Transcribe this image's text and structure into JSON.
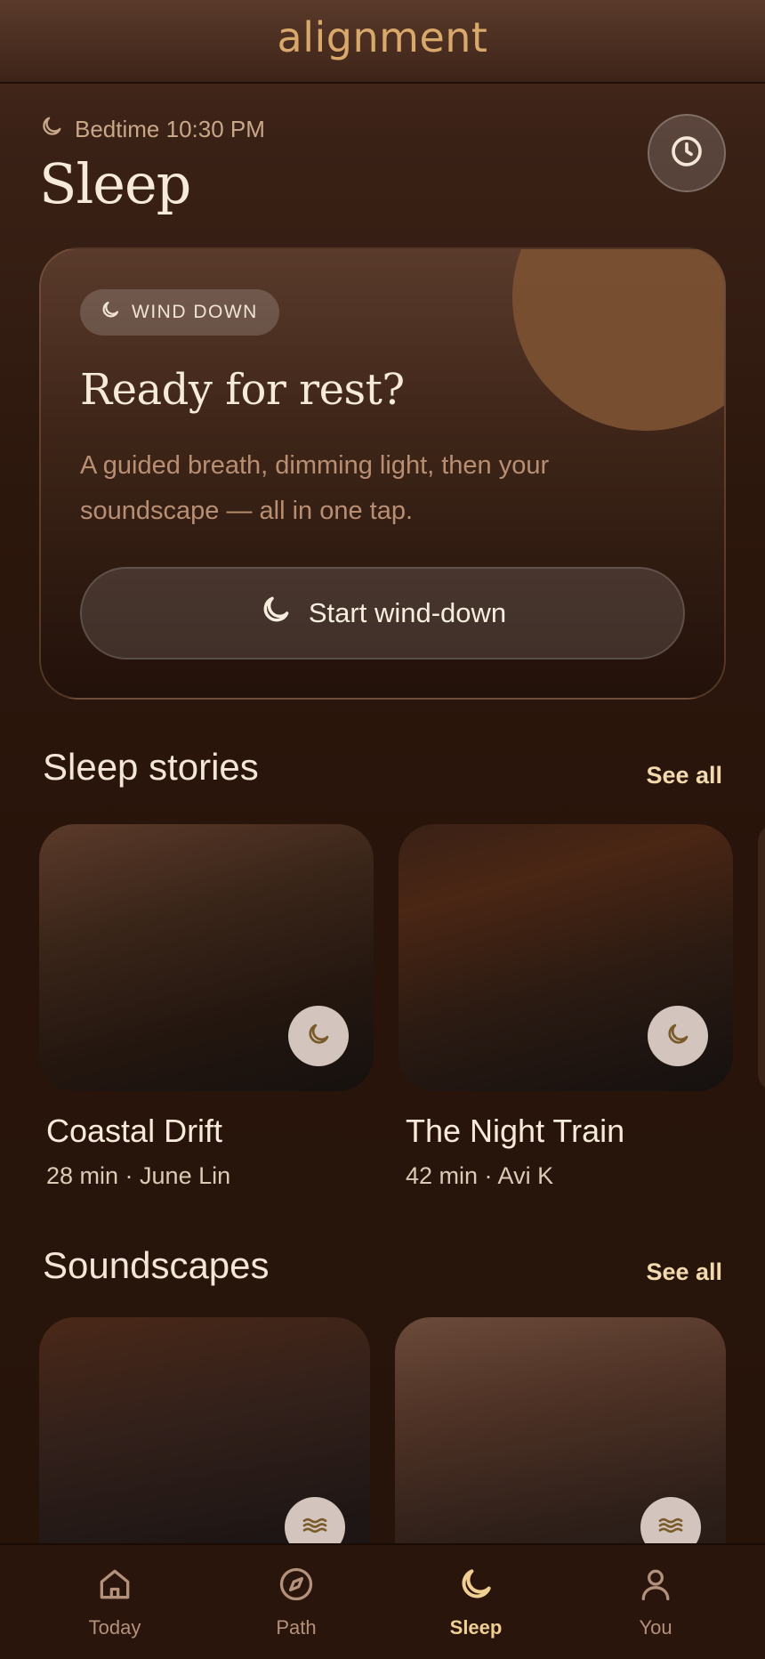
{
  "app": {
    "logo_text": "alignment"
  },
  "header": {
    "bedtime_text": "Bedtime 10:30 PM",
    "title": "Sleep"
  },
  "wind_down": {
    "badge": "WIND DOWN",
    "title": "Ready for rest?",
    "description": "A guided breath, dimming light, then your soundscape — all in one tap.",
    "button_label": "Start wind-down"
  },
  "sleep_stories": {
    "section_title": "Sleep stories",
    "see_all": "See all",
    "items": [
      {
        "title": "Coastal Drift",
        "meta": "28 min · June Lin"
      },
      {
        "title": "The Night Train",
        "meta": "42 min · Avi K"
      }
    ]
  },
  "soundscapes": {
    "section_title": "Soundscapes",
    "see_all": "See all"
  },
  "nav": {
    "items": [
      {
        "label": "Today",
        "icon": "home-icon"
      },
      {
        "label": "Path",
        "icon": "compass-icon"
      },
      {
        "label": "Sleep",
        "icon": "moon-icon",
        "active": true
      },
      {
        "label": "You",
        "icon": "user-icon"
      }
    ]
  },
  "colors": {
    "accent": "#f0cf93",
    "logo": "#d9a96b",
    "background": "#2a150c"
  }
}
